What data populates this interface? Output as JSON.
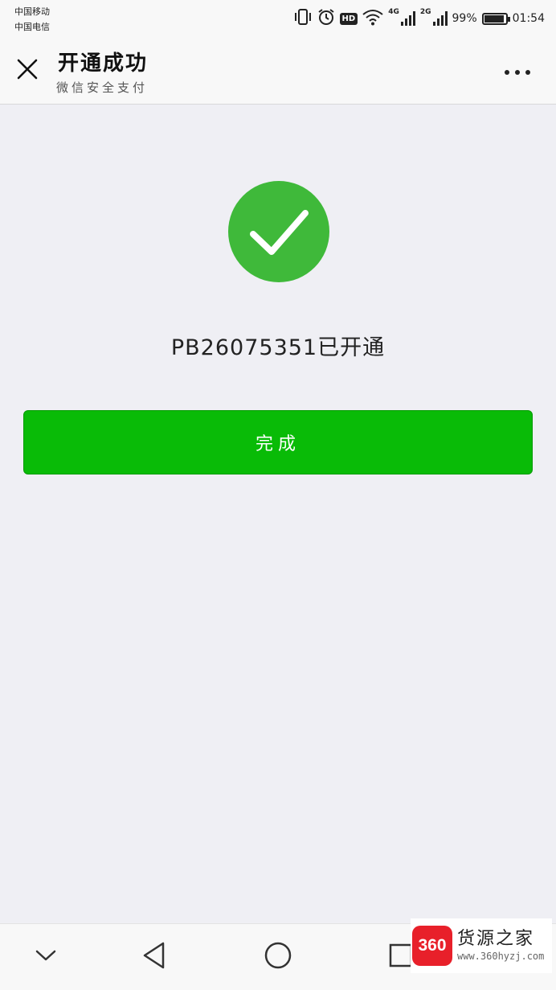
{
  "status_bar": {
    "carrier_1": "中国移动",
    "carrier_2": "中国电信",
    "hd_label": "HD",
    "network_1": "4G",
    "network_2": "2G",
    "battery_percent": "99%",
    "battery_level": 0.99,
    "time": "01:54",
    "icons": [
      "vibrate-icon",
      "alarm-icon",
      "hd-icon",
      "wifi-icon",
      "signal-icon",
      "battery-icon"
    ]
  },
  "nav": {
    "title": "开通成功",
    "subtitle": "微信安全支付",
    "close_icon": "close-icon",
    "more_icon": "more-icon"
  },
  "result": {
    "icon": "success-check-icon",
    "message": "PB26075351已开通"
  },
  "actions": {
    "done_label": "完成"
  },
  "system_nav": {
    "icons": [
      "chevron-down-icon",
      "back-icon",
      "home-icon",
      "recents-icon"
    ]
  },
  "watermark": {
    "logo_text": "360",
    "name": "货源之家",
    "url": "www.360hyzj.com"
  },
  "colors": {
    "primary_green": "#09bb07",
    "success_circle": "#3fb93a",
    "background": "#efeff4",
    "watermark_red": "#e8202a"
  }
}
